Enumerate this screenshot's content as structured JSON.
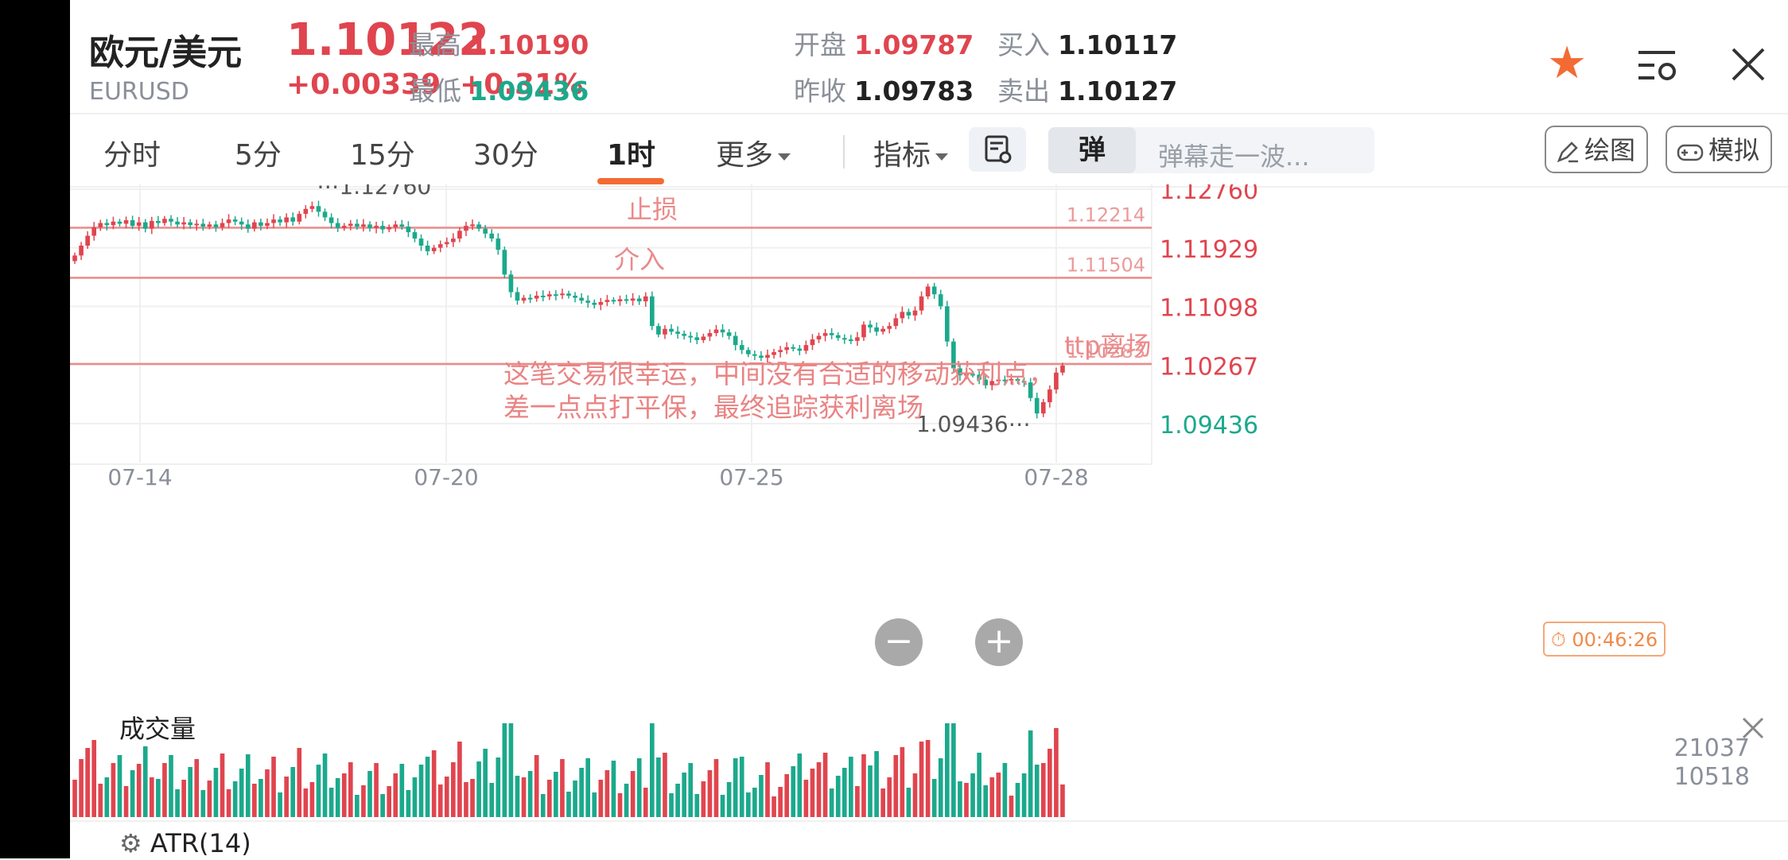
{
  "header": {
    "pair_name": "欧元/美元",
    "pair_code": "EURUSD",
    "price": "1.10122",
    "change": "+0.00339",
    "change_pct": "+0.31%",
    "stats": [
      {
        "label": "最高",
        "value": "1.10190",
        "color": "red"
      },
      {
        "label": "最低",
        "value": "1.09436",
        "color": "green"
      },
      {
        "label": "开盘",
        "value": "1.09787",
        "color": "red"
      },
      {
        "label": "昨收",
        "value": "1.09783",
        "color": "dark"
      },
      {
        "label": "买入",
        "value": "1.10117",
        "color": "dark"
      },
      {
        "label": "卖出",
        "value": "1.10127",
        "color": "dark"
      }
    ],
    "icons": [
      "star-icon",
      "menu-settings-icon",
      "close-icon"
    ]
  },
  "toolbar": {
    "timeframes": [
      "分时",
      "5分",
      "15分",
      "30分",
      "1时",
      "更多"
    ],
    "active_timeframe": "1时",
    "indicator_label": "指标",
    "danmu_toggle": "弹",
    "danmu_placeholder": "弹幕走一波...",
    "draw_label": "绘图",
    "simulate_label": "模拟"
  },
  "chart_data": {
    "type": "candlestick",
    "y_ticks": [
      "1.12760",
      "1.11929",
      "1.11098",
      "1.10267",
      "1.09436"
    ],
    "ylim": [
      1.09436,
      1.1276
    ],
    "x_ticks": [
      "07-14",
      "07-20",
      "07-25",
      "07-28"
    ],
    "high_label": "1.12760",
    "low_label": "1.09436",
    "last_price": "1.10122",
    "horizontal_lines": [
      {
        "value": 1.12214,
        "label": "止损",
        "price_label": "1.12214"
      },
      {
        "value": 1.11504,
        "label": "介入",
        "price_label": "1.11504"
      },
      {
        "value": 1.10283,
        "label": "ttp离场",
        "price_label": "1.10283"
      }
    ],
    "annotation_lines": [
      "这笔交易很幸运，中间没有合适的移动获利点，",
      "差一点点打平保，最终追踪获利离场"
    ],
    "closes": [
      1.1182,
      1.1196,
      1.121,
      1.1222,
      1.1228,
      1.1225,
      1.123,
      1.1227,
      1.1232,
      1.1224,
      1.1229,
      1.122,
      1.1231,
      1.1228,
      1.1234,
      1.123,
      1.1226,
      1.1229,
      1.1225,
      1.1227,
      1.1223,
      1.1226,
      1.1222,
      1.1228,
      1.1233,
      1.123,
      1.1226,
      1.122,
      1.1229,
      1.1224,
      1.1228,
      1.1233,
      1.1229,
      1.1236,
      1.123,
      1.1241,
      1.1248,
      1.1252,
      1.1244,
      1.1236,
      1.1228,
      1.1221,
      1.1224,
      1.1227,
      1.1223,
      1.1226,
      1.1221,
      1.1224,
      1.1219,
      1.1222,
      1.1226,
      1.1223,
      1.1215,
      1.1206,
      1.1196,
      1.1188,
      1.1193,
      1.1198,
      1.1201,
      1.1206,
      1.1217,
      1.1224,
      1.1226,
      1.122,
      1.1213,
      1.1206,
      1.119,
      1.1155,
      1.113,
      1.1118,
      1.1122,
      1.1121,
      1.1125,
      1.1124,
      1.1127,
      1.1126,
      1.1128,
      1.1125,
      1.1122,
      1.1118,
      1.1115,
      1.1112,
      1.1116,
      1.1119,
      1.1117,
      1.112,
      1.1118,
      1.1121,
      1.1117,
      1.1124,
      1.1082,
      1.107,
      1.1078,
      1.1074,
      1.1071,
      1.1068,
      1.1066,
      1.1062,
      1.1067,
      1.1072,
      1.1077,
      1.1073,
      1.1068,
      1.1055,
      1.1048,
      1.1042,
      1.104,
      1.1037,
      1.1041,
      1.1045,
      1.1048,
      1.1052,
      1.105,
      1.1047,
      1.1055,
      1.1063,
      1.1068,
      1.1072,
      1.1069,
      1.1065,
      1.1063,
      1.1061,
      1.1066,
      1.1084,
      1.108,
      1.1074,
      1.1078,
      1.1082,
      1.1093,
      1.1102,
      1.1097,
      1.1104,
      1.1124,
      1.1138,
      1.1127,
      1.111,
      1.106,
      1.1022,
      1.1012,
      1.1014,
      1.1013,
      1.1006,
      1.0998,
      1.1004,
      1.1006,
      1.1005,
      1.1007,
      1.1004,
      1.1002,
      1.098,
      1.0958,
      1.0974,
      1.0992,
      1.1016,
      1.1026
    ],
    "volume_ticks": [
      "21037",
      "10518"
    ],
    "volume_title": "成交量",
    "atr_label": "ATR(14)",
    "timer": "00:46:26"
  }
}
